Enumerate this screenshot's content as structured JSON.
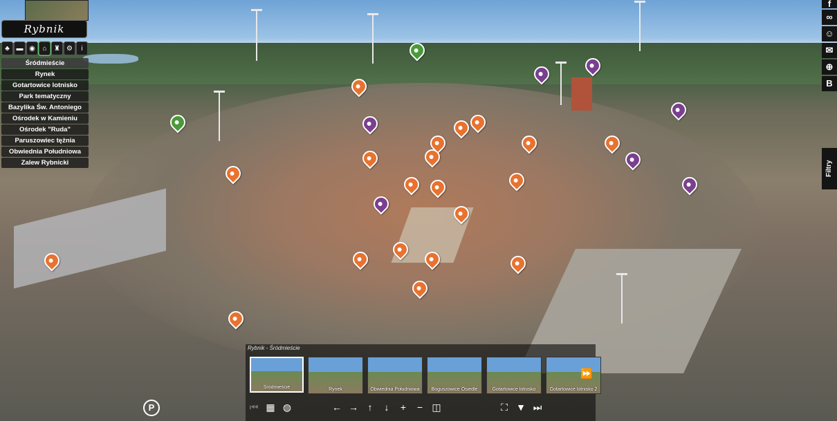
{
  "location_title": "Rybnik",
  "category_icons": [
    "trees-icon",
    "bed-icon",
    "car-icon",
    "basket-icon",
    "monument-icon",
    "bike-icon",
    "info-icon"
  ],
  "locations": [
    "Śródmieście",
    "Rynek",
    "Gotartowice lotnisko",
    "Park tematyczny",
    "Bazylika Św. Antoniego",
    "Ośrodek w Kamieniu",
    "Ośrodek \"Ruda\"",
    "Paruszowiec tężnia",
    "Obwiednia Południowa",
    "Zalew Rybnicki"
  ],
  "right_toolbar": [
    "facebook-icon",
    "tripadvisor-icon",
    "people-icon",
    "envelope-icon",
    "plus-circle-icon",
    "b-icon"
  ],
  "filters_label": "Filtry",
  "gallery": {
    "current_title": "Rybnik - Śródmieście",
    "thumbnails": [
      "Śródmieście",
      "Rynek",
      "Obwiednia Południowa",
      "Boguszowice Osiedle",
      "Gotartowice lotnisko",
      "Gotartowice lotnisko 2"
    ]
  },
  "parking_badge": "P"
}
